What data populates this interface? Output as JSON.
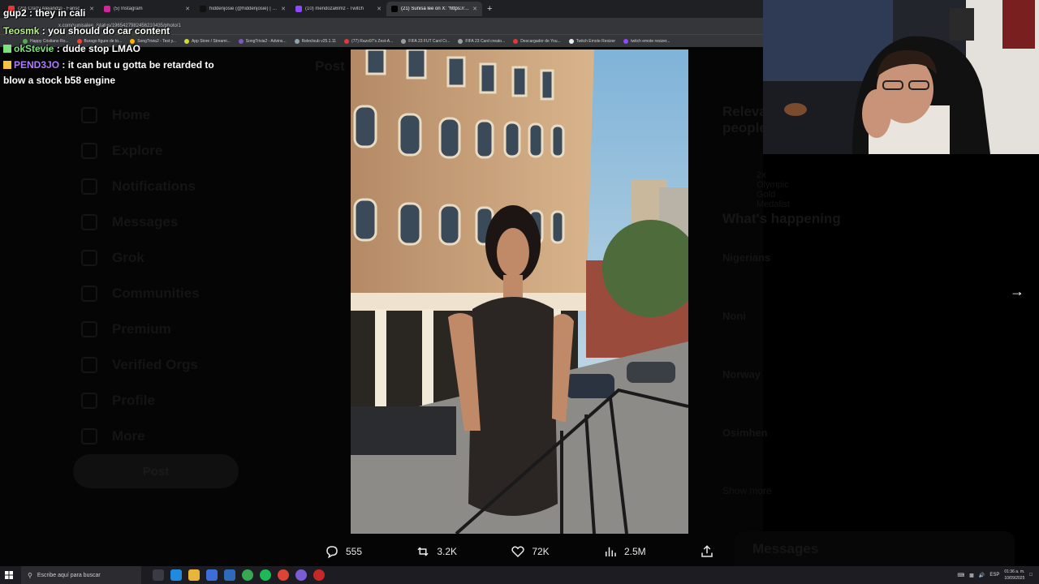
{
  "browser": {
    "tabs": [
      {
        "label": "(20) Crazy Alejandro - Fanscore",
        "color": "#e53935",
        "active": false
      },
      {
        "label": "(5) Instagram",
        "color": "#d6249f",
        "active": false
      },
      {
        "label": "hiddenjosie (@hiddenjosie) | TikTok",
        "color": "#111111",
        "active": false
      },
      {
        "label": "(10) mendoza6lmz - Twitch",
        "color": "#9146ff",
        "active": false
      },
      {
        "label": "(21) Sunisa lee on X: \"https://t...",
        "color": "#000000",
        "active": true
      }
    ],
    "new_tab": "+",
    "url": "x.com/sunisalee_/status/1965427982456210435/photo/1",
    "bookmarks": [
      {
        "label": "Happy Cristiano Ro...",
        "color": "#4caf50"
      },
      {
        "label": "Burago figure de to...",
        "color": "#f44336"
      },
      {
        "label": "SongTrivia2 - Test y...",
        "color": "#ffb300"
      },
      {
        "label": "App Store / Streami...",
        "color": "#cddc39"
      },
      {
        "label": "SongTrivia2 - Advins...",
        "color": "#7e57c2"
      },
      {
        "label": "Relecloub v25.1.11",
        "color": "#90a4ae"
      },
      {
        "label": "(77) Razo97's Zest-A...",
        "color": "#e53935"
      },
      {
        "label": "FIFA 23 FUT Card Cr...",
        "color": "#9e9e9e"
      },
      {
        "label": "FIFA 23 Card creato...",
        "color": "#9e9e9e"
      },
      {
        "label": "Descargador de You...",
        "color": "#e53935"
      },
      {
        "label": "Twitch Emote Resizer",
        "color": "#eeeeee"
      },
      {
        "label": "twitch emote resizer...",
        "color": "#9146ff"
      }
    ]
  },
  "chat": [
    {
      "user": "gup2",
      "color": "#ffffff",
      "message": "they in cali"
    },
    {
      "user": "Teosmk",
      "color": "#b8f08a",
      "message": "you should do car content"
    },
    {
      "user": "okStevie",
      "color": "#7fe07f",
      "message": "dude stop LMAO"
    },
    {
      "user": "PEND3JO",
      "color": "#b07cff",
      "message": "it can but u gotta be retarded to blow a stock b58 engine"
    }
  ],
  "background": {
    "header": "Post",
    "sidebar": [
      "Home",
      "Explore",
      "Notifications",
      "Messages",
      "Grok",
      "Communities",
      "Premium",
      "Verified Orgs",
      "Profile",
      "More"
    ],
    "post_button": "Post",
    "right_title": "What's happening",
    "right_items": [
      "Nigerians",
      "Noni",
      "Norway",
      "Osimhen"
    ],
    "relevant": "Relevant people",
    "relevant_bio": "2x Olympic Gold Medalist",
    "show_more": "Show more",
    "messages": "Messages"
  },
  "actions": {
    "replies": "555",
    "reposts": "3.2K",
    "likes": "72K",
    "views": "2.5M"
  },
  "taskbar": {
    "search_placeholder": "Escribe aquí para buscar",
    "language": "ESP",
    "time": "01:36 a. m.",
    "date": "10/09/2025"
  }
}
